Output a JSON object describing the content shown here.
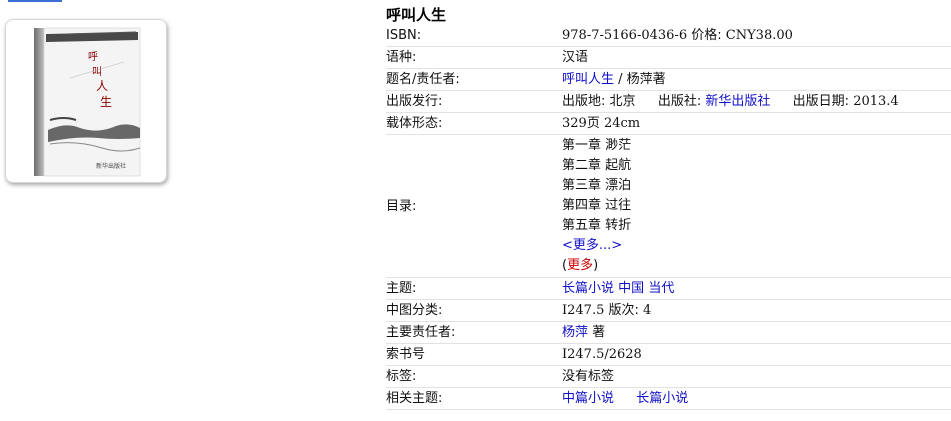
{
  "book": {
    "title": "呼叫人生",
    "cover_alt": "book-cover",
    "cover_text_vertical": "呼叫人生"
  },
  "rows": {
    "isbn": {
      "label": "ISBN:",
      "value": "978-7-5166-0436-6",
      "price_label": "价格:",
      "price": "CNY38.00"
    },
    "language": {
      "label": "语种:",
      "value": "汉语"
    },
    "title_author": {
      "label": "题名/责任者:",
      "title_link": "呼叫人生",
      "sep": " / ",
      "author": "杨萍著"
    },
    "publication": {
      "label": "出版发行:",
      "place_label": "出版地:",
      "place": "北京",
      "publisher_label": "出版社:",
      "publisher": "新华出版社",
      "date_label": "出版日期:",
      "date": "2013.4"
    },
    "physical": {
      "label": "载体形态:",
      "value": "329页 24cm"
    },
    "toc": {
      "label": "目录:",
      "items": [
        "第一章 渺茫",
        "第二章 起航",
        "第三章 漂泊",
        "第四章 过往",
        "第五章 转折"
      ],
      "more_link": "<更多...>",
      "more_paren_open": "(",
      "more_red": "更多",
      "more_paren_close": ")"
    },
    "subject": {
      "label": "主题:",
      "links": [
        "长篇小说",
        "中国",
        "当代"
      ]
    },
    "classification": {
      "label": "中图分类:",
      "value": "I247.5",
      "edition_label": "版次:",
      "edition": "4"
    },
    "main_author": {
      "label": "主要责任者:",
      "author_link": "杨萍",
      "role": "著"
    },
    "call_number": {
      "label": "索书号",
      "value": "I247.5/2628"
    },
    "tags": {
      "label": "标签:",
      "value": "没有标签"
    },
    "related": {
      "label": "相关主题:",
      "links": [
        "中篇小说",
        "长篇小说"
      ]
    }
  }
}
